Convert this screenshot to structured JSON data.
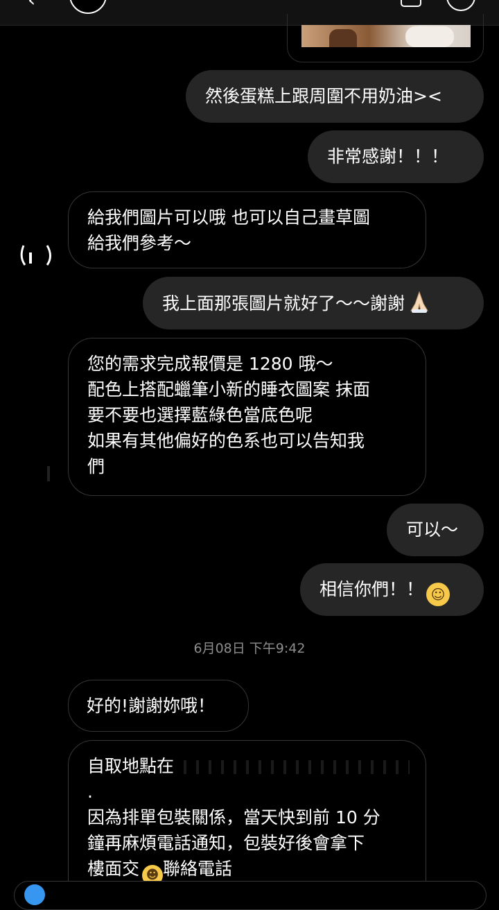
{
  "header": {
    "back_icon": "back-arrow-icon",
    "action_icons": [
      "video-icon",
      "info-icon"
    ]
  },
  "messages": {
    "m1": "然後蛋糕上跟周圍不用奶油><",
    "m2": "非常感謝！！！",
    "m3": [
      "給我們圖片可以哦 也可以自己畫草圖",
      "給我們參考～"
    ],
    "m4": "我上面那張圖片就好了～～謝謝",
    "m4_emoji": "folded-hands-emoji",
    "m5": [
      "您的需求完成報價是 1280 哦～",
      "配色上搭配蠟筆小新的睡衣圖案 抹面",
      "要不要也選擇藍綠色當底色呢",
      "如果有其他偏好的色系也可以告知我",
      "們"
    ],
    "m6": "可以～",
    "m7": "相信你們！！",
    "m7_emoji": "laughing-tears-emoji",
    "timestamp": "6月08日 下午9:42",
    "m8": "好的!謝謝妳哦！",
    "m9": [
      "自取地點在",
      ".",
      "因為排單包裝關係，當天快到前 10 分",
      "鐘再麻煩電話通知，包裝好後會拿下",
      "樓面交",
      "聯絡電話"
    ],
    "m9_emoji": "grinning-emoji"
  },
  "colors": {
    "background": "#000000",
    "sent_bubble": "#262626",
    "recv_border": "#363636",
    "timestamp": "#8e8e8e",
    "accent": "#3797f0"
  }
}
